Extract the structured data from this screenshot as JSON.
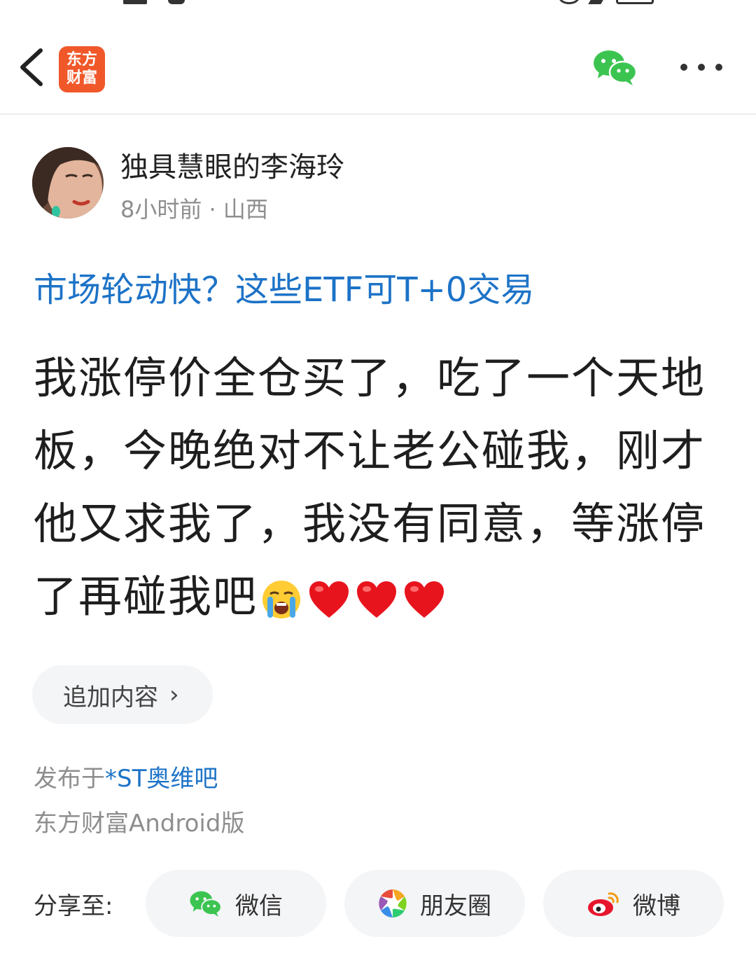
{
  "header": {
    "logo_line1": "东方",
    "logo_line2": "财富",
    "back_icon": "chevron-left-icon",
    "share_icon": "wechat-icon",
    "more_icon": "more-dots-icon"
  },
  "author": {
    "name": "独具慧眼的李海玲",
    "meta": "8小时前 · 山西"
  },
  "post": {
    "topic": "市场轮动快？这些ETF可T+0交易",
    "body": "我涨停价全仓买了，吃了一个天地板，今晚绝对不让老公碰我，刚才他又求我了，我没有同意，等涨停了再碰我吧",
    "emojis": [
      "loudly-crying-face-icon",
      "heart-icon",
      "heart-icon",
      "heart-icon"
    ]
  },
  "append_button": {
    "label": "追加内容",
    "chevron": "›"
  },
  "footer": {
    "published_prefix": "发布于",
    "bar_name": "*ST奥维吧",
    "client": "东方财富Android版"
  },
  "share": {
    "label": "分享至:",
    "wechat": "微信",
    "moments": "朋友圈",
    "weibo": "微博"
  },
  "colors": {
    "brand_orange": "#f0582a",
    "link_blue": "#1d73c7",
    "wechat_green": "#3cc451",
    "weibo_red": "#e6162d"
  }
}
